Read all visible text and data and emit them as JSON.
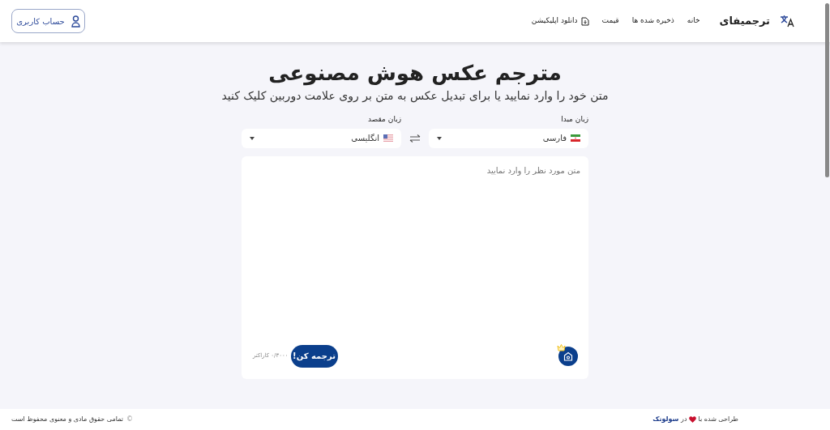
{
  "header": {
    "brand": "ترجمیفای",
    "nav": [
      {
        "label": "خانه",
        "kind": "link"
      },
      {
        "label": "ذخیره شده ها",
        "kind": "link"
      },
      {
        "label": "قیمت",
        "kind": "link"
      },
      {
        "label": "دانلود اپلیکیشن",
        "kind": "download"
      }
    ],
    "account_button": "حساب کاربری"
  },
  "hero": {
    "title": "مترجم عکس هوش مصنوعی",
    "subtitle": "متن خود را وارد نمایید یا برای تبدیل عکس به متن بر روی علامت دوربین کلیک کنید"
  },
  "languages": [
    {
      "label": "زبان مبدا",
      "value": "فارسی",
      "kind": "iran"
    },
    {
      "label": "زبان مقصد",
      "value": "انگلیسی",
      "kind": "usa"
    }
  ],
  "editor": {
    "placeholder": "متن مورد نظر را وارد نمایید",
    "counter": "۰/۳۰۰۰ کاراکتر",
    "translate_button": "ترجمه کن!"
  },
  "footer": {
    "credit_prefix": "طراحی شده با",
    "credit_middle": "در",
    "credit_brand": "سولوتک",
    "copyright_symbol": "©",
    "copyright": "تمامی حقوق مادی و معنوی محفوظ است"
  }
}
